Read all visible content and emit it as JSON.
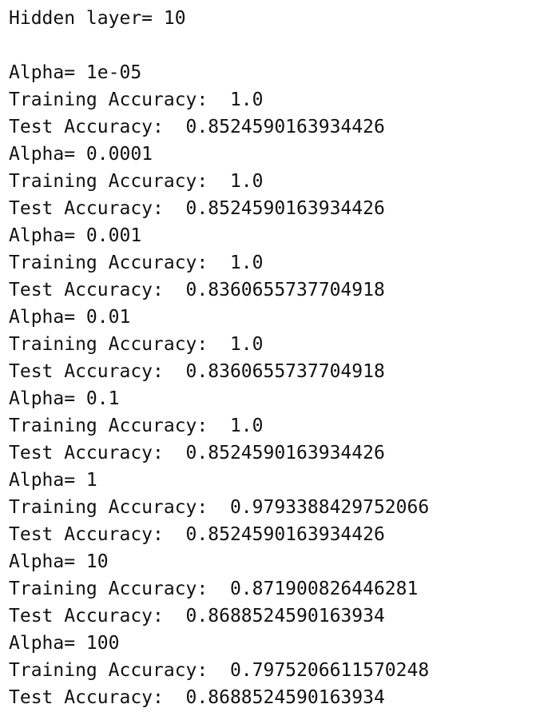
{
  "header": {
    "hidden_layer": "Hidden layer= 10"
  },
  "results": [
    {
      "alpha": "Alpha= 1e-05",
      "training": "Training Accuracy:  1.0",
      "test": "Test Accuracy:  0.8524590163934426"
    },
    {
      "alpha": "Alpha= 0.0001",
      "training": "Training Accuracy:  1.0",
      "test": "Test Accuracy:  0.8524590163934426"
    },
    {
      "alpha": "Alpha= 0.001",
      "training": "Training Accuracy:  1.0",
      "test": "Test Accuracy:  0.8360655737704918"
    },
    {
      "alpha": "Alpha= 0.01",
      "training": "Training Accuracy:  1.0",
      "test": "Test Accuracy:  0.8360655737704918"
    },
    {
      "alpha": "Alpha= 0.1",
      "training": "Training Accuracy:  1.0",
      "test": "Test Accuracy:  0.8524590163934426"
    },
    {
      "alpha": "Alpha= 1",
      "training": "Training Accuracy:  0.9793388429752066",
      "test": "Test Accuracy:  0.8524590163934426"
    },
    {
      "alpha": "Alpha= 10",
      "training": "Training Accuracy:  0.871900826446281",
      "test": "Test Accuracy:  0.8688524590163934"
    },
    {
      "alpha": "Alpha= 100",
      "training": "Training Accuracy:  0.7975206611570248",
      "test": "Test Accuracy:  0.8688524590163934"
    }
  ]
}
